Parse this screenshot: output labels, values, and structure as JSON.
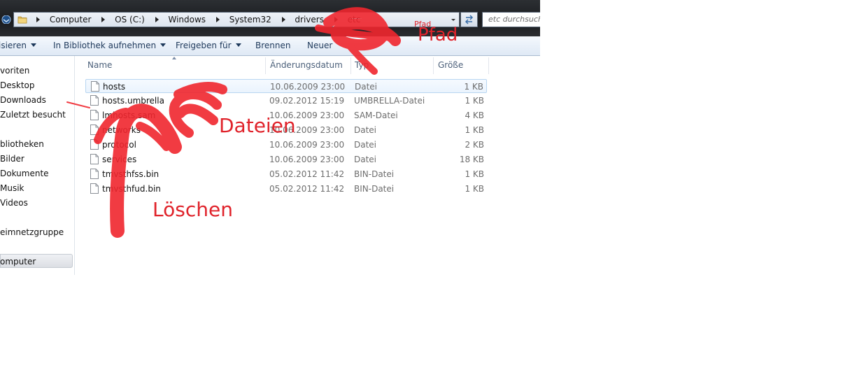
{
  "address": {
    "breadcrumbs": [
      "Computer",
      "OS (C:)",
      "Windows",
      "System32",
      "drivers",
      "etc"
    ],
    "search_placeholder": "etc durchsuchen"
  },
  "toolbar": {
    "organize_label": "isieren",
    "library_label": "In Bibliothek aufnehmen",
    "share_label": "Freigeben für",
    "burn_label": "Brennen",
    "new_label": "Neuer"
  },
  "sidebar": {
    "items": [
      "voriten",
      "Desktop",
      "Downloads",
      "Zuletzt besucht",
      "bliotheken",
      "Bilder",
      "Dokumente",
      "Musik",
      "Videos",
      "eimnetzgruppe",
      "omputer"
    ]
  },
  "columns": {
    "name": "Name",
    "date": "Änderungsdatum",
    "type": "Typ",
    "size": "Größe"
  },
  "files": [
    {
      "name": "hosts",
      "date": "10.06.2009 23:00",
      "type": "Datei",
      "size": "1 KB"
    },
    {
      "name": "hosts.umbrella",
      "date": "09.02.2012 15:19",
      "type": "UMBRELLA-Datei",
      "size": "1 KB"
    },
    {
      "name": "lmhosts.sam",
      "date": "10.06.2009 23:00",
      "type": "SAM-Datei",
      "size": "4 KB"
    },
    {
      "name": "networks",
      "date": "10.06.2009 23:00",
      "type": "Datei",
      "size": "1 KB"
    },
    {
      "name": "protocol",
      "date": "10.06.2009 23:00",
      "type": "Datei",
      "size": "2 KB"
    },
    {
      "name": "services",
      "date": "10.06.2009 23:00",
      "type": "Datei",
      "size": "18 KB"
    },
    {
      "name": "tmvsthfss.bin",
      "date": "05.02.2012 11:42",
      "type": "BIN-Datei",
      "size": "1 KB"
    },
    {
      "name": "tmvsthfud.bin",
      "date": "05.02.2012 11:42",
      "type": "BIN-Datei",
      "size": "1 KB"
    }
  ],
  "annotations": {
    "pfad_small": "Pfad",
    "pfad": "Pfad",
    "dateien": "Dateien",
    "loeschen": "Löschen"
  },
  "colors": {
    "annotation_red": "#e0232b",
    "toolbar_text": "#1e395b",
    "selection_border": "#b8d6f1"
  },
  "icons": [
    "folder-icon",
    "back-arrow-icon",
    "chevron-down-icon",
    "refresh-icon",
    "file-icon"
  ]
}
